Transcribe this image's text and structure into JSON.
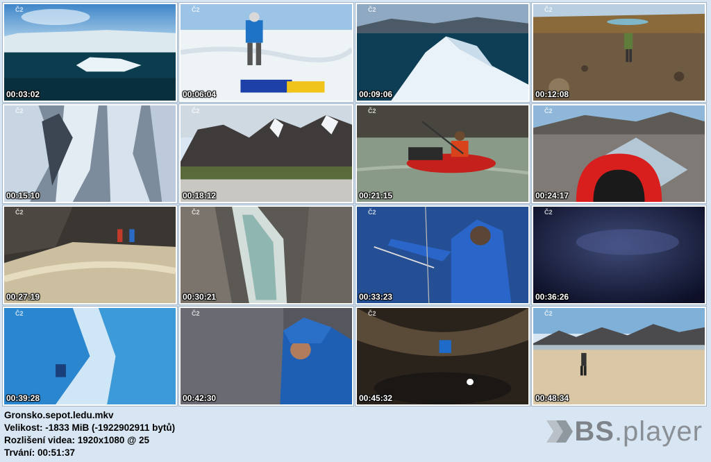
{
  "thumbnails": [
    {
      "time": "00:03:02",
      "channel": "Č2",
      "icon": "iceberg-scene"
    },
    {
      "time": "00:06:04",
      "channel": "Č2",
      "icon": "climber-snow-scene"
    },
    {
      "time": "00:09:06",
      "channel": "Č2",
      "icon": "ice-floe-scene"
    },
    {
      "time": "00:12:08",
      "channel": "Č2",
      "icon": "hiker-tundra-scene"
    },
    {
      "time": "00:15:10",
      "channel": "Č2",
      "icon": "glacier-crevasse-scene"
    },
    {
      "time": "00:18:12",
      "channel": "Č2",
      "icon": "mountain-valley-scene"
    },
    {
      "time": "00:21:15",
      "channel": "Č2",
      "icon": "packraft-paddler-scene"
    },
    {
      "time": "00:24:17",
      "channel": "Č2",
      "icon": "packraft-bow-scene"
    },
    {
      "time": "00:27:19",
      "channel": "Č2",
      "icon": "cliff-climbers-scene"
    },
    {
      "time": "00:30:21",
      "channel": "Č2",
      "icon": "meltwater-channel-scene"
    },
    {
      "time": "00:33:23",
      "channel": "Č2",
      "icon": "blue-jacket-rope-scene"
    },
    {
      "time": "00:36:26",
      "channel": "Č2",
      "icon": "dark-ice-cave-scene"
    },
    {
      "time": "00:39:28",
      "channel": "Č2",
      "icon": "blue-ice-tunnel-scene"
    },
    {
      "time": "00:42:30",
      "channel": "Č2",
      "icon": "hooded-explorer-scene"
    },
    {
      "time": "00:45:32",
      "channel": "Č2",
      "icon": "cave-headlamp-scene"
    },
    {
      "time": "00:48:34",
      "channel": "Č2",
      "icon": "sand-plain-hiker-scene"
    }
  ],
  "info": {
    "filename": "Gronsko.sepot.ledu.mkv",
    "size": "Velikost: -1833 MiB (-1922902911 bytů)",
    "resolution": "Rozlišení videa: 1920x1080 @ 25",
    "duration": "Trvání: 00:51:37"
  },
  "logo": {
    "prefix": "BS",
    "suffix": ".player"
  }
}
